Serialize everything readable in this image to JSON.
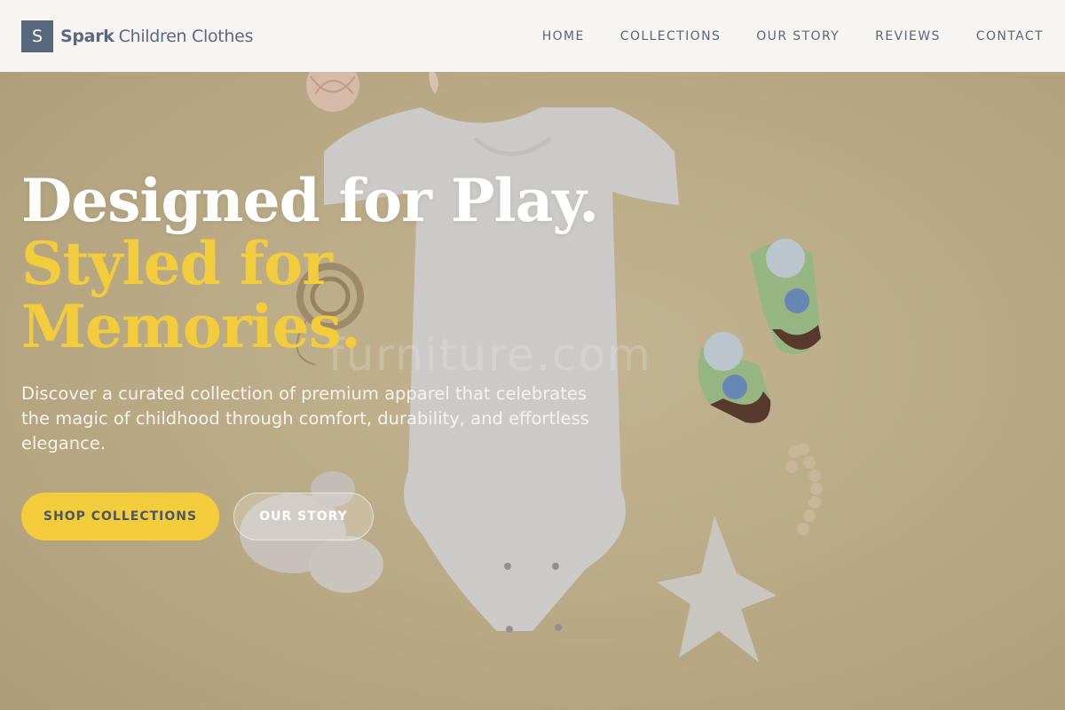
{
  "brand": {
    "mark": "S",
    "name_bold": "Spark",
    "name_regular": "Children Clothes"
  },
  "nav": [
    "HOME",
    "COLLECTIONS",
    "OUR STORY",
    "REVIEWS",
    "CONTACT"
  ],
  "hero": {
    "headline_line1": "Designed for Play.",
    "headline_line2": "Styled for",
    "headline_line3": "Memories.",
    "description": "Discover a curated collection of premium apparel that celebrates the magic of childhood through comfort, durability, and effortless elegance.",
    "primary_button": "SHOP COLLECTIONS",
    "secondary_button": "OUR STORY",
    "watermark": "furniture.com"
  },
  "colors": {
    "accent": "#f3cc3c",
    "brand": "#59677c",
    "header_bg": "#f7f5f2",
    "hero_bg": "#c9b993"
  },
  "icons": [
    "onesie-image",
    "socks-image",
    "star-pillow-image",
    "twine-image",
    "teether-image"
  ]
}
